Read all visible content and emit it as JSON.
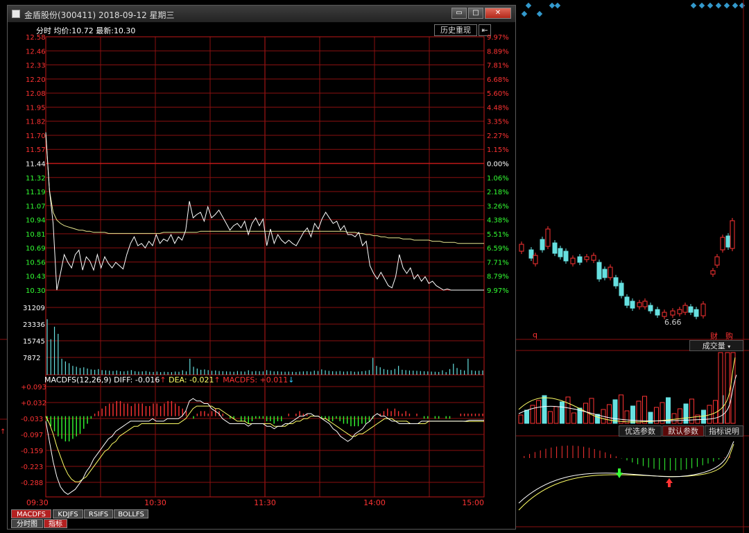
{
  "window": {
    "title": "金盾股份(300411) 2018-09-12 星期三",
    "buttons": [
      "▭",
      "□",
      "✕"
    ]
  },
  "info": {
    "mode": "分时",
    "avg_label": "均价:",
    "avg_value": "10.72",
    "last_label": "最新:",
    "last_value": "10.30",
    "history_button": "历史重现",
    "history_arrow": "⇤"
  },
  "price_axis": {
    "left": [
      "12.58",
      "12.46",
      "12.33",
      "12.20",
      "12.08",
      "11.95",
      "11.82",
      "11.70",
      "11.57",
      "11.44",
      "11.32",
      "11.19",
      "11.07",
      "10.94",
      "10.81",
      "10.69",
      "10.56",
      "10.43",
      "10.30"
    ],
    "right": [
      "9.97%",
      "8.89%",
      "7.81%",
      "6.68%",
      "5.60%",
      "4.48%",
      "3.35%",
      "2.27%",
      "1.15%",
      "0.00%",
      "1.06%",
      "2.18%",
      "3.26%",
      "4.38%",
      "5.51%",
      "6.59%",
      "7.71%",
      "8.79%",
      "9.97%"
    ]
  },
  "volume_axis": [
    "31209",
    "23336",
    "15745",
    "7872"
  ],
  "macd_header": {
    "name": "MACDFS(12,26,9)",
    "diff_label": "DIFF:",
    "diff_value": "-0.016",
    "diff_arrow": "↑",
    "dea_label": "DEA:",
    "dea_value": "-0.021",
    "dea_arrow": "↑",
    "macd_label": "MACDFS:",
    "macd_value": "+0.011",
    "macd_arrow": "↓"
  },
  "macd_axis": [
    "+0.093",
    "+0.032",
    "-0.033",
    "-0.097",
    "-0.159",
    "-0.223",
    "-0.288"
  ],
  "time_axis": [
    "09:30",
    "10:30",
    "11:30",
    "14:00",
    "15:00"
  ],
  "indicator_tabs": [
    "MACDFS",
    "KDJFS",
    "RSIFS",
    "BOLLFS"
  ],
  "bottom_tabs": [
    "分时图",
    "指标"
  ],
  "right_panel": {
    "price_label": "6.66",
    "q_label": "q",
    "cai_label": "财",
    "gou_label": "购",
    "volume_select": "成交量",
    "param_buttons": [
      "优选参数",
      "默认参数",
      "指标说明"
    ]
  },
  "colors": {
    "up": "#ff3333",
    "down": "#33ff33",
    "price_line": "#ffffff",
    "avg_line": "#e8e890",
    "grid": "#8a1010",
    "dif": "#ffffff",
    "dea": "#ffff66",
    "volume_bar": "#66e0e0"
  },
  "chart_data": {
    "type": "line",
    "series": [
      {
        "values": [
          11.72,
          11.2,
          10.9,
          10.3,
          10.45,
          10.62,
          10.55,
          10.5,
          10.62,
          10.66,
          10.48,
          10.6,
          10.56,
          10.48,
          10.62,
          10.5,
          10.6,
          10.54,
          10.5,
          10.55,
          10.52,
          10.49,
          10.62,
          10.72,
          10.78,
          10.7,
          10.72,
          10.68,
          10.74,
          10.7,
          10.8,
          10.72,
          10.76,
          10.74,
          10.8,
          10.72,
          10.78,
          10.75,
          10.84,
          11.1,
          10.95,
          10.98,
          11.0,
          10.92,
          11.05,
          10.95,
          10.98,
          11.02,
          10.96,
          10.9,
          10.84,
          10.88,
          10.9,
          10.86,
          10.92,
          10.8,
          10.9,
          10.95,
          10.88,
          10.94,
          10.7,
          10.85,
          10.72,
          10.8,
          10.75,
          10.72,
          10.75,
          10.72,
          10.7,
          10.76,
          10.82,
          10.86,
          10.78,
          10.9,
          10.85,
          10.94,
          11.0,
          10.95,
          10.9,
          10.92,
          10.84,
          10.88,
          10.8,
          10.8,
          10.78,
          10.82,
          10.7,
          10.74,
          10.52,
          10.45,
          10.4,
          10.46,
          10.4,
          10.34,
          10.32,
          10.42,
          10.62,
          10.5,
          10.45,
          10.5,
          10.4,
          10.44,
          10.38,
          10.42,
          10.36,
          10.38,
          10.34,
          10.32,
          10.3,
          10.31,
          10.3,
          10.3,
          10.3,
          10.3,
          10.3,
          10.3,
          10.3,
          10.3,
          10.3,
          10.3
        ]
      },
      {
        "values": [
          11.7,
          11.2,
          11.0,
          10.93,
          10.9,
          10.88,
          10.87,
          10.86,
          10.85,
          10.84,
          10.84,
          10.83,
          10.83,
          10.82,
          10.82,
          10.82,
          10.82,
          10.81,
          10.81,
          10.81,
          10.81,
          10.81,
          10.81,
          10.81,
          10.81,
          10.81,
          10.81,
          10.81,
          10.81,
          10.81,
          10.81,
          10.81,
          10.82,
          10.82,
          10.82,
          10.82,
          10.82,
          10.82,
          10.82,
          10.82,
          10.82,
          10.82,
          10.83,
          10.83,
          10.83,
          10.83,
          10.83,
          10.83,
          10.83,
          10.83,
          10.83,
          10.83,
          10.83,
          10.83,
          10.83,
          10.83,
          10.83,
          10.83,
          10.83,
          10.83,
          10.83,
          10.83,
          10.83,
          10.83,
          10.83,
          10.83,
          10.83,
          10.83,
          10.83,
          10.83,
          10.83,
          10.83,
          10.83,
          10.83,
          10.83,
          10.83,
          10.83,
          10.83,
          10.83,
          10.83,
          10.83,
          10.83,
          10.82,
          10.82,
          10.82,
          10.81,
          10.81,
          10.8,
          10.8,
          10.79,
          10.79,
          10.78,
          10.78,
          10.77,
          10.77,
          10.77,
          10.77,
          10.76,
          10.76,
          10.76,
          10.75,
          10.75,
          10.75,
          10.75,
          10.75,
          10.74,
          10.74,
          10.74,
          10.73,
          10.73,
          10.73,
          10.73,
          10.72,
          10.72,
          10.72,
          10.72,
          10.72,
          10.72,
          10.72,
          10.72
        ]
      }
    ],
    "ylim": [
      10.3,
      12.58
    ],
    "volume": [
      31209,
      20000,
      27000,
      23000,
      9000,
      7500,
      6500,
      5000,
      4500,
      3800,
      4200,
      3500,
      3000,
      2800,
      3200,
      2600,
      2500,
      2300,
      2100,
      2400,
      2000,
      1900,
      2200,
      2600,
      2000,
      1800,
      1900,
      2100,
      1700,
      1600,
      1800,
      1500,
      1700,
      1600,
      1500,
      1800,
      1700,
      2500,
      1900,
      9000,
      4500,
      3500,
      2800,
      3000,
      2600,
      2200,
      2400,
      2100,
      2000,
      1900,
      1800,
      1700,
      2100,
      1900,
      1800,
      2500,
      1900,
      2100,
      2000,
      1900,
      2600,
      2200,
      1900,
      2000,
      1800,
      1700,
      1800,
      1700,
      1600,
      1800,
      1900,
      2000,
      1800,
      2300,
      2100,
      3000,
      2500,
      2200,
      2000,
      1900,
      2100,
      1800,
      1900,
      2000,
      1700,
      1800,
      2000,
      2200,
      2600,
      9500,
      5000,
      4200,
      3200,
      2800,
      2600,
      3300,
      5000,
      2800,
      2600,
      2400,
      2300,
      2200,
      2100,
      2000,
      1900,
      1800,
      1700,
      1600,
      2500,
      1500,
      3200,
      6200,
      3800,
      2800,
      2400,
      9000,
      2500,
      2200,
      2300,
      2400
    ],
    "volume_ylim": [
      0,
      39000
    ],
    "macd": [
      -0.02,
      -0.04,
      -0.06,
      -0.08,
      -0.09,
      -0.1,
      -0.1,
      -0.09,
      -0.08,
      -0.07,
      -0.05,
      -0.03,
      -0.01,
      0.01,
      0.02,
      0.03,
      0.04,
      0.05,
      0.05,
      0.06,
      0.06,
      0.05,
      0.05,
      0.04,
      0.05,
      0.05,
      0.05,
      0.04,
      0.04,
      0.05,
      0.05,
      0.04,
      0.05,
      0.06,
      0.06,
      0.05,
      0.04,
      0.03,
      0.02,
      0.0,
      -0.01,
      0.01,
      0.02,
      0.02,
      0.01,
      0.02,
      0.03,
      0.02,
      0.01,
      0.0,
      -0.01,
      -0.01,
      0.0,
      -0.02,
      -0.02,
      -0.03,
      -0.02,
      -0.01,
      -0.01,
      -0.01,
      -0.02,
      -0.02,
      -0.03,
      -0.02,
      -0.02,
      0.0,
      0.01,
      0.0,
      0.01,
      0.02,
      0.01,
      0.01,
      0.0,
      0.0,
      0.0,
      -0.01,
      -0.01,
      -0.02,
      -0.02,
      -0.01,
      -0.02,
      -0.03,
      -0.03,
      -0.04,
      -0.04,
      -0.04,
      -0.03,
      -0.03,
      -0.02,
      -0.01,
      0.0,
      0.01,
      0.02,
      0.03,
      0.02,
      0.03,
      0.02,
      0.01,
      0.02,
      0.01,
      0.0,
      0.01,
      0.0,
      -0.01,
      -0.01,
      0.0,
      -0.01,
      -0.01,
      0.0,
      -0.01,
      -0.01,
      0.0,
      0.0,
      0.01,
      0.01,
      0.01,
      0.01,
      0.01,
      0.01,
      0.01
    ],
    "dif": [
      -0.02,
      -0.1,
      -0.18,
      -0.24,
      -0.28,
      -0.3,
      -0.31,
      -0.3,
      -0.29,
      -0.27,
      -0.25,
      -0.22,
      -0.2,
      -0.17,
      -0.15,
      -0.13,
      -0.11,
      -0.09,
      -0.08,
      -0.06,
      -0.05,
      -0.04,
      -0.03,
      -0.02,
      -0.02,
      -0.02,
      -0.02,
      -0.02,
      -0.02,
      -0.01,
      -0.02,
      -0.02,
      -0.02,
      -0.01,
      -0.01,
      -0.01,
      -0.01,
      0.0,
      0.02,
      0.06,
      0.07,
      0.06,
      0.06,
      0.05,
      0.05,
      0.03,
      0.02,
      0.01,
      -0.01,
      -0.02,
      -0.03,
      -0.03,
      -0.03,
      -0.03,
      -0.03,
      -0.04,
      -0.03,
      -0.03,
      -0.03,
      -0.03,
      -0.04,
      -0.04,
      -0.05,
      -0.04,
      -0.04,
      -0.03,
      -0.03,
      -0.02,
      -0.01,
      0.0,
      0.0,
      0.01,
      0.01,
      0.0,
      0.0,
      -0.01,
      -0.02,
      -0.03,
      -0.05,
      -0.06,
      -0.08,
      -0.09,
      -0.1,
      -0.09,
      -0.07,
      -0.06,
      -0.05,
      -0.03,
      -0.02,
      0.0,
      0.01,
      0.0,
      0.0,
      -0.01,
      -0.02,
      -0.02,
      -0.03,
      -0.03,
      -0.03,
      -0.03,
      -0.03,
      -0.03,
      -0.02,
      -0.02,
      -0.02,
      -0.02,
      -0.02,
      -0.02,
      -0.02,
      -0.02,
      -0.02,
      -0.02,
      -0.02,
      -0.02,
      -0.02,
      -0.016,
      -0.016,
      -0.016,
      -0.016,
      -0.016
    ],
    "dea": [
      0.0,
      -0.03,
      -0.07,
      -0.12,
      -0.16,
      -0.2,
      -0.23,
      -0.25,
      -0.26,
      -0.26,
      -0.25,
      -0.24,
      -0.22,
      -0.2,
      -0.18,
      -0.16,
      -0.14,
      -0.13,
      -0.11,
      -0.1,
      -0.08,
      -0.07,
      -0.06,
      -0.05,
      -0.04,
      -0.04,
      -0.03,
      -0.03,
      -0.03,
      -0.03,
      -0.03,
      -0.03,
      -0.03,
      -0.03,
      -0.03,
      -0.03,
      -0.03,
      -0.02,
      -0.01,
      0.01,
      0.03,
      0.04,
      0.04,
      0.04,
      0.04,
      0.04,
      0.03,
      0.03,
      0.02,
      0.01,
      0.0,
      -0.01,
      -0.02,
      -0.02,
      -0.02,
      -0.03,
      -0.03,
      -0.03,
      -0.03,
      -0.03,
      -0.03,
      -0.03,
      -0.04,
      -0.04,
      -0.04,
      -0.04,
      -0.03,
      -0.03,
      -0.02,
      -0.02,
      -0.01,
      -0.01,
      0.0,
      0.0,
      0.0,
      -0.01,
      -0.01,
      -0.02,
      -0.03,
      -0.04,
      -0.05,
      -0.06,
      -0.07,
      -0.08,
      -0.08,
      -0.07,
      -0.07,
      -0.06,
      -0.05,
      -0.04,
      -0.03,
      -0.02,
      -0.01,
      -0.01,
      -0.01,
      -0.02,
      -0.02,
      -0.02,
      -0.02,
      -0.03,
      -0.03,
      -0.03,
      -0.03,
      -0.03,
      -0.02,
      -0.02,
      -0.02,
      -0.02,
      -0.02,
      -0.02,
      -0.02,
      -0.02,
      -0.02,
      -0.02,
      -0.021,
      -0.021,
      -0.021,
      -0.021,
      -0.021,
      -0.021
    ],
    "macd_ylim": [
      -0.32,
      0.12
    ]
  }
}
